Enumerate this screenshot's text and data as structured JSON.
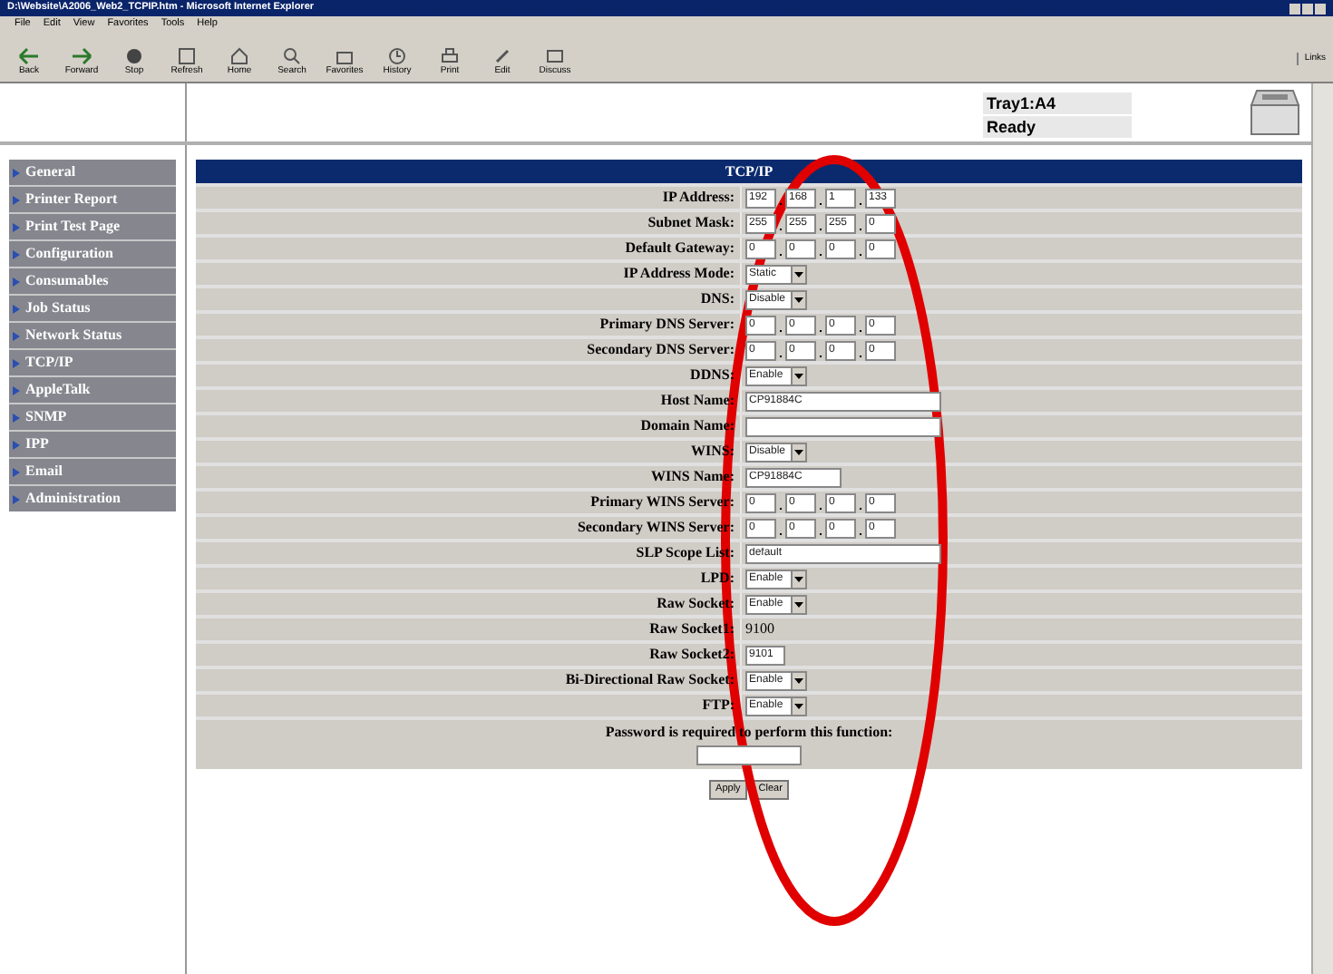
{
  "window": {
    "title": "D:\\Website\\A2006_Web2_TCPIP.htm - Microsoft Internet Explorer"
  },
  "menu": [
    "File",
    "Edit",
    "View",
    "Favorites",
    "Tools",
    "Help"
  ],
  "toolbar": [
    {
      "label": "Back",
      "kind": "back"
    },
    {
      "label": "Forward",
      "kind": "forward"
    },
    {
      "label": "Stop",
      "kind": "stop"
    },
    {
      "label": "Refresh",
      "kind": "refresh"
    },
    {
      "label": "Home",
      "kind": "home"
    },
    {
      "label": "Search",
      "kind": "search"
    },
    {
      "label": "Favorites",
      "kind": "favorites"
    },
    {
      "label": "History",
      "kind": "history"
    },
    {
      "label": "Print",
      "kind": "print"
    },
    {
      "label": "Edit",
      "kind": "edit"
    },
    {
      "label": "Discuss",
      "kind": "discuss"
    }
  ],
  "links_label": "Links",
  "printer_status": {
    "tray": "Tray1:A4",
    "state": "Ready"
  },
  "sidebar": {
    "items": [
      {
        "label": "General"
      },
      {
        "label": "Printer Report"
      },
      {
        "label": "Print Test Page"
      },
      {
        "label": "Configuration"
      },
      {
        "label": "Consumables"
      },
      {
        "label": "Job Status"
      },
      {
        "label": "Network Status"
      },
      {
        "label": "TCP/IP"
      },
      {
        "label": "AppleTalk"
      },
      {
        "label": "SNMP"
      },
      {
        "label": "IPP"
      },
      {
        "label": "Email"
      },
      {
        "label": "Administration"
      }
    ]
  },
  "form": {
    "title": "TCP/IP",
    "rows": [
      {
        "label": "IP Address:",
        "kind": "ip",
        "octets": [
          "192",
          "168",
          "1",
          "133"
        ]
      },
      {
        "label": "Subnet Mask:",
        "kind": "ip",
        "octets": [
          "255",
          "255",
          "255",
          "0"
        ]
      },
      {
        "label": "Default Gateway:",
        "kind": "ip",
        "octets": [
          "0",
          "0",
          "0",
          "0"
        ]
      },
      {
        "label": "IP Address Mode:",
        "kind": "select",
        "value": "Static"
      },
      {
        "label": "DNS:",
        "kind": "select",
        "value": "Disable"
      },
      {
        "label": "Primary DNS Server:",
        "kind": "ip",
        "octets": [
          "0",
          "0",
          "0",
          "0"
        ]
      },
      {
        "label": "Secondary DNS Server:",
        "kind": "ip",
        "octets": [
          "0",
          "0",
          "0",
          "0"
        ]
      },
      {
        "label": "DDNS:",
        "kind": "select",
        "value": "Enable"
      },
      {
        "label": "Host Name:",
        "kind": "long_input",
        "value": "CP91884C"
      },
      {
        "label": "Domain Name:",
        "kind": "long_input"
      },
      {
        "label": "WINS:",
        "kind": "select",
        "value": "Disable"
      },
      {
        "label": "WINS Name:",
        "kind": "medium_input",
        "value": "CP91884C"
      },
      {
        "label": "Primary WINS Server:",
        "kind": "ip",
        "octets": [
          "0",
          "0",
          "0",
          "0"
        ]
      },
      {
        "label": "Secondary WINS Server:",
        "kind": "ip",
        "octets": [
          "0",
          "0",
          "0",
          "0"
        ]
      },
      {
        "label": "SLP Scope List:",
        "kind": "long_input",
        "value": "default"
      },
      {
        "label": "LPD:",
        "kind": "select",
        "value": "Enable"
      },
      {
        "label": "Raw Socket:",
        "kind": "select",
        "value": "Enable"
      },
      {
        "label": "Raw Socket1:",
        "kind": "static",
        "value": "9100"
      },
      {
        "label": "Raw Socket2:",
        "kind": "short_input",
        "value": "9101"
      },
      {
        "label": "Bi-Directional Raw Socket:",
        "kind": "select",
        "value": "Enable"
      },
      {
        "label": "FTP:",
        "kind": "select",
        "value": "Enable"
      }
    ],
    "password_prompt": "Password is required to perform this function:",
    "buttons": [
      "Apply",
      "Clear"
    ]
  }
}
